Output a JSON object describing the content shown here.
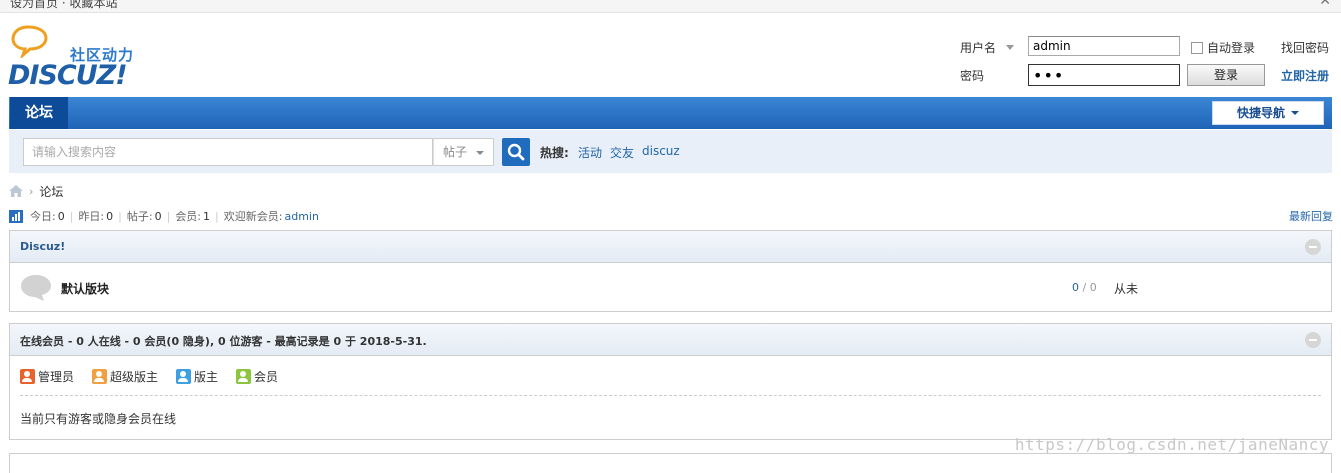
{
  "window": {
    "title": "设为首页 · 收藏本站"
  },
  "logo": {
    "slogan": "社区动力",
    "wordmark": "DISCUZ!"
  },
  "login": {
    "username_label": "用户名",
    "username_value": "admin",
    "autologin_label": "自动登录",
    "forgot_link": "找回密码",
    "password_label": "密码",
    "password_value": "•••",
    "login_button": "登录",
    "register_link": "立即注册"
  },
  "nav": {
    "active_tab": "论坛",
    "quick_nav": "快捷导航"
  },
  "search": {
    "placeholder": "请输入搜索内容",
    "type": "帖子",
    "hot_label": "热搜:",
    "hot_terms": [
      "活动",
      "交友",
      "discuz"
    ]
  },
  "breadcrumb": {
    "sep": "›",
    "current": "论坛"
  },
  "stats": {
    "today_label": "今日:",
    "today_value": "0",
    "yesterday_label": "昨日:",
    "yesterday_value": "0",
    "posts_label": "帖子:",
    "posts_value": "0",
    "members_label": "会员:",
    "members_value": "1",
    "welcome_label": "欢迎新会员:",
    "welcome_user": "admin",
    "recent_reply": "最新回复"
  },
  "category": {
    "title": "Discuz!",
    "forums": [
      {
        "name": "默认版块",
        "threads": "0",
        "posts": "0",
        "last_post": "从未"
      }
    ]
  },
  "online": {
    "title": "在线会员 - 0 人在线 - 0 会员(0 隐身), 0 位游客 - 最高记录是 0 于 2018-5-31.",
    "legend": [
      {
        "label": "管理员",
        "color": "#e8622c"
      },
      {
        "label": "超级版主",
        "color": "#f0a040"
      },
      {
        "label": "版主",
        "color": "#3ea0e0"
      },
      {
        "label": "会员",
        "color": "#8cc63e"
      }
    ],
    "note": "当前只有游客或隐身会员在线"
  },
  "watermark": "https://blog.csdn.net/janeNancy",
  "colors": {
    "nav_blue": "#1f63b7",
    "link_blue": "#2366a8",
    "search_bg": "#e8eff8"
  }
}
